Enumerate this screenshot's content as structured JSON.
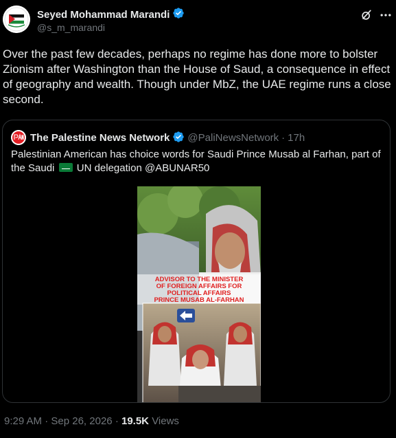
{
  "author": {
    "name": "Seyed Mohammad Marandi",
    "handle": "@s_m_marandi"
  },
  "tweet": {
    "text": "Over the past few decades, perhaps no regime has done more to bolster Zionism after Washington than the House of Saud, a consequence in effect of geography and wealth. Though under MbZ, the UAE regime runs a close second."
  },
  "quote": {
    "name": "The Palestine News Network",
    "handle": "@PaliNewsNetwork",
    "separator": "·",
    "time": "17h",
    "text_before_flag": "Palestinian American has choice words for Saudi Prince Musab al Farhan, part of the Saudi",
    "text_after_flag": "UN delegation @ABUNAR50",
    "video_caption_lines": [
      "ADVISOR TO THE MINISTER",
      "OF FOREIGN AFFAIRS FOR",
      "POLITICAL AFFAIRS",
      "PRINCE MUSAB AL-FARHAN"
    ]
  },
  "meta": {
    "time": "9:29 AM",
    "separator": "·",
    "date": "Sep 26, 2026",
    "separator2": "·",
    "views_count": "19.5K",
    "views_label": "Views"
  },
  "icons": {
    "verified": "verified-badge-icon",
    "grok": "grok-icon",
    "more": "more-options-icon"
  },
  "colors": {
    "background": "#000000",
    "text": "#e7e9ea",
    "secondary": "#71767b",
    "verified_blue": "#1d9bf0",
    "border": "#2f3336",
    "caption_red": "#e02020"
  }
}
